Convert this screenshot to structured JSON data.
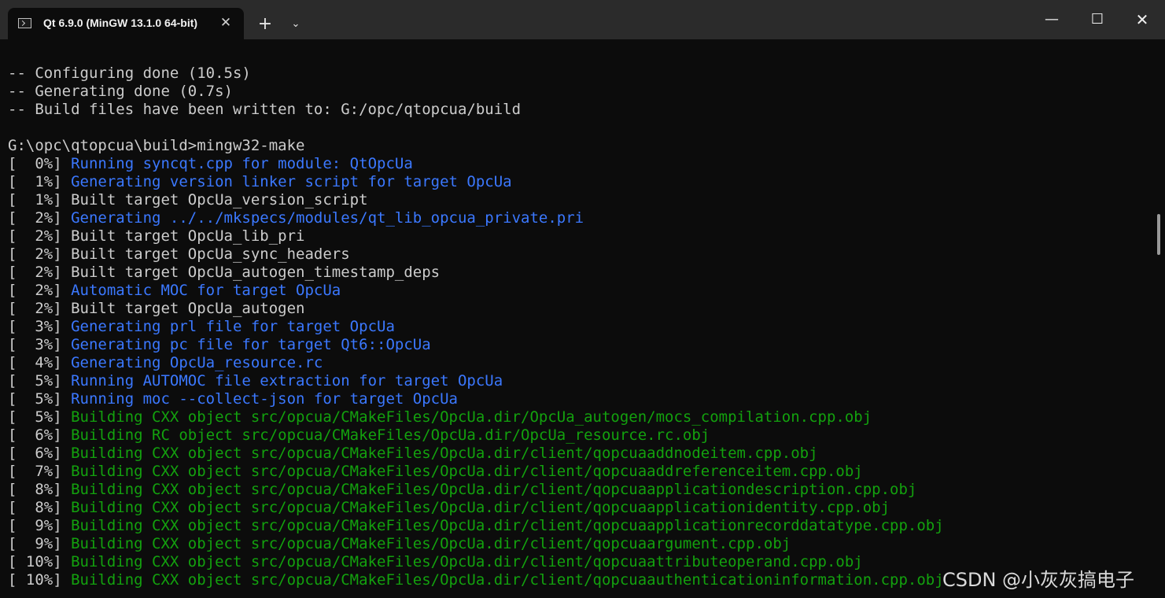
{
  "window": {
    "tab_title": "Qt 6.9.0 (MinGW 13.1.0 64-bit)",
    "tab_close": "✕",
    "new_tab": "+",
    "dropdown": "⌄",
    "minimize": "—",
    "maximize": "☐",
    "close": "✕"
  },
  "colors": {
    "white": "#cccccc",
    "blue": "#3b78ff",
    "green": "#13a10e"
  },
  "terminal": {
    "lines": [
      {
        "text": "-- Configuring done (10.5s)",
        "color": "white"
      },
      {
        "text": "-- Generating done (0.7s)",
        "color": "white"
      },
      {
        "text": "-- Build files have been written to: G:/opc/qtopcua/build",
        "color": "white"
      },
      {
        "text": "",
        "color": "white"
      },
      {
        "text": "G:\\opc\\qtopcua\\build>mingw32-make",
        "color": "white"
      },
      {
        "prefix": "[  0%] ",
        "text": "Running syncqt.cpp for module: QtOpcUa",
        "color": "blue"
      },
      {
        "prefix": "[  1%] ",
        "text": "Generating version linker script for target OpcUa",
        "color": "blue"
      },
      {
        "prefix": "[  1%] ",
        "text": "Built target OpcUa_version_script",
        "color": "white"
      },
      {
        "prefix": "[  2%] ",
        "text": "Generating ../../mkspecs/modules/qt_lib_opcua_private.pri",
        "color": "blue"
      },
      {
        "prefix": "[  2%] ",
        "text": "Built target OpcUa_lib_pri",
        "color": "white"
      },
      {
        "prefix": "[  2%] ",
        "text": "Built target OpcUa_sync_headers",
        "color": "white"
      },
      {
        "prefix": "[  2%] ",
        "text": "Built target OpcUa_autogen_timestamp_deps",
        "color": "white"
      },
      {
        "prefix": "[  2%] ",
        "text": "Automatic MOC for target OpcUa",
        "color": "blue"
      },
      {
        "prefix": "[  2%] ",
        "text": "Built target OpcUa_autogen",
        "color": "white"
      },
      {
        "prefix": "[  3%] ",
        "text": "Generating prl file for target OpcUa",
        "color": "blue"
      },
      {
        "prefix": "[  3%] ",
        "text": "Generating pc file for target Qt6::OpcUa",
        "color": "blue"
      },
      {
        "prefix": "[  4%] ",
        "text": "Generating OpcUa_resource.rc",
        "color": "blue"
      },
      {
        "prefix": "[  5%] ",
        "text": "Running AUTOMOC file extraction for target OpcUa",
        "color": "blue"
      },
      {
        "prefix": "[  5%] ",
        "text": "Running moc --collect-json for target OpcUa",
        "color": "blue"
      },
      {
        "prefix": "[  5%] ",
        "text": "Building CXX object src/opcua/CMakeFiles/OpcUa.dir/OpcUa_autogen/mocs_compilation.cpp.obj",
        "color": "green"
      },
      {
        "prefix": "[  6%] ",
        "text": "Building RC object src/opcua/CMakeFiles/OpcUa.dir/OpcUa_resource.rc.obj",
        "color": "green"
      },
      {
        "prefix": "[  6%] ",
        "text": "Building CXX object src/opcua/CMakeFiles/OpcUa.dir/client/qopcuaaddnodeitem.cpp.obj",
        "color": "green"
      },
      {
        "prefix": "[  7%] ",
        "text": "Building CXX object src/opcua/CMakeFiles/OpcUa.dir/client/qopcuaaddreferenceitem.cpp.obj",
        "color": "green"
      },
      {
        "prefix": "[  8%] ",
        "text": "Building CXX object src/opcua/CMakeFiles/OpcUa.dir/client/qopcuaapplicationdescription.cpp.obj",
        "color": "green"
      },
      {
        "prefix": "[  8%] ",
        "text": "Building CXX object src/opcua/CMakeFiles/OpcUa.dir/client/qopcuaapplicationidentity.cpp.obj",
        "color": "green"
      },
      {
        "prefix": "[  9%] ",
        "text": "Building CXX object src/opcua/CMakeFiles/OpcUa.dir/client/qopcuaapplicationrecorddatatype.cpp.obj",
        "color": "green"
      },
      {
        "prefix": "[  9%] ",
        "text": "Building CXX object src/opcua/CMakeFiles/OpcUa.dir/client/qopcuaargument.cpp.obj",
        "color": "green"
      },
      {
        "prefix": "[ 10%] ",
        "text": "Building CXX object src/opcua/CMakeFiles/OpcUa.dir/client/qopcuaattributeoperand.cpp.obj",
        "color": "green"
      },
      {
        "prefix": "[ 10%] ",
        "text": "Building CXX object src/opcua/CMakeFiles/OpcUa.dir/client/qopcuaauthenticationinformation.cpp.obj",
        "color": "green"
      }
    ]
  },
  "watermark": "CSDN @小灰灰搞电子"
}
